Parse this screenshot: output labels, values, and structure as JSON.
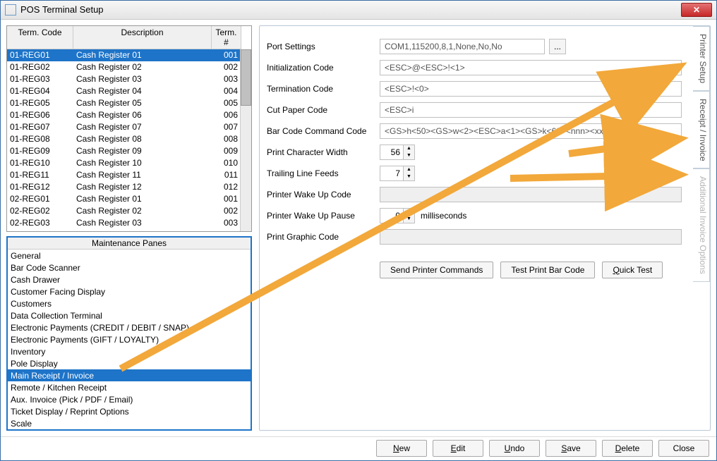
{
  "window": {
    "title": "POS Terminal Setup"
  },
  "terminal_table": {
    "headers": {
      "code": "Term. Code",
      "desc": "Description",
      "num": "Term. #"
    },
    "rows": [
      {
        "code": "01-REG01",
        "desc": "Cash Register 01",
        "num": "001",
        "selected": true
      },
      {
        "code": "01-REG02",
        "desc": "Cash Register 02",
        "num": "002"
      },
      {
        "code": "01-REG03",
        "desc": "Cash Register 03",
        "num": "003"
      },
      {
        "code": "01-REG04",
        "desc": "Cash Register 04",
        "num": "004"
      },
      {
        "code": "01-REG05",
        "desc": "Cash Register 05",
        "num": "005"
      },
      {
        "code": "01-REG06",
        "desc": "Cash Register 06",
        "num": "006"
      },
      {
        "code": "01-REG07",
        "desc": "Cash Register 07",
        "num": "007"
      },
      {
        "code": "01-REG08",
        "desc": "Cash Register 08",
        "num": "008"
      },
      {
        "code": "01-REG09",
        "desc": "Cash Register 09",
        "num": "009"
      },
      {
        "code": "01-REG10",
        "desc": "Cash Register 10",
        "num": "010"
      },
      {
        "code": "01-REG11",
        "desc": "Cash Register 11",
        "num": "011"
      },
      {
        "code": "01-REG12",
        "desc": "Cash Register 12",
        "num": "012"
      },
      {
        "code": "02-REG01",
        "desc": "Cash Register 01",
        "num": "001"
      },
      {
        "code": "02-REG02",
        "desc": "Cash Register 02",
        "num": "002"
      },
      {
        "code": "02-REG03",
        "desc": "Cash Register 03",
        "num": "003"
      }
    ]
  },
  "maintenance_panes": {
    "header": "Maintenance Panes",
    "items": [
      "General",
      "Bar Code Scanner",
      "Cash Drawer",
      "Customer Facing Display",
      "Customers",
      "Data Collection Terminal",
      "Electronic Payments (CREDIT / DEBIT / SNAP)",
      "Electronic Payments (GIFT /  LOYALTY)",
      "Inventory",
      "Pole Display",
      "Main Receipt / Invoice",
      "Remote / Kitchen Receipt",
      "Aux. Invoice (Pick / PDF / Email)",
      "Ticket Display / Reprint Options",
      "Scale"
    ],
    "selected_index": 10
  },
  "form": {
    "port_settings": {
      "label": "Port Settings",
      "value": "COM1,115200,8,1,None,No,No",
      "more": "..."
    },
    "init_code": {
      "label": "Initialization Code",
      "value": "<ESC>@<ESC>!<1>"
    },
    "term_code": {
      "label": "Termination Code",
      "value": "<ESC>!<0>"
    },
    "cut_paper": {
      "label": "Cut Paper Code",
      "value": "<ESC>i"
    },
    "barcode_cmd": {
      "label": "Bar Code Command Code",
      "value": "<GS>h<50><GS>w<2><ESC>a<1><GS>k<69><nnn><xxx><ESC>a<0>"
    },
    "char_width": {
      "label": "Print Character Width",
      "value": "56"
    },
    "trailing_feeds": {
      "label": "Trailing Line Feeds",
      "value": "7"
    },
    "wakeup_code": {
      "label": "Printer Wake Up Code",
      "value": ""
    },
    "wakeup_pause": {
      "label": "Printer Wake Up Pause",
      "value": "0",
      "suffix": "milliseconds"
    },
    "graphic_code": {
      "label": "Print Graphic Code",
      "value": ""
    }
  },
  "form_buttons": {
    "send": "Send Printer Commands",
    "test_barcode": "Test Print Bar Code",
    "quick_test_prefix": "Q",
    "quick_test_rest": "uick Test"
  },
  "side_tabs": {
    "printer_setup": "Printer Setup",
    "receipt_invoice": "Receipt / Invoice",
    "additional": "Additional Invoice Options"
  },
  "bottom_buttons": {
    "new": {
      "ul": "N",
      "rest": "ew"
    },
    "edit": {
      "ul": "E",
      "rest": "dit"
    },
    "undo": {
      "ul": "U",
      "rest": "ndo"
    },
    "save": {
      "ul": "S",
      "rest": "ave"
    },
    "delete": {
      "ul": "D",
      "rest": "elete"
    },
    "close": {
      "text": "Close"
    }
  }
}
